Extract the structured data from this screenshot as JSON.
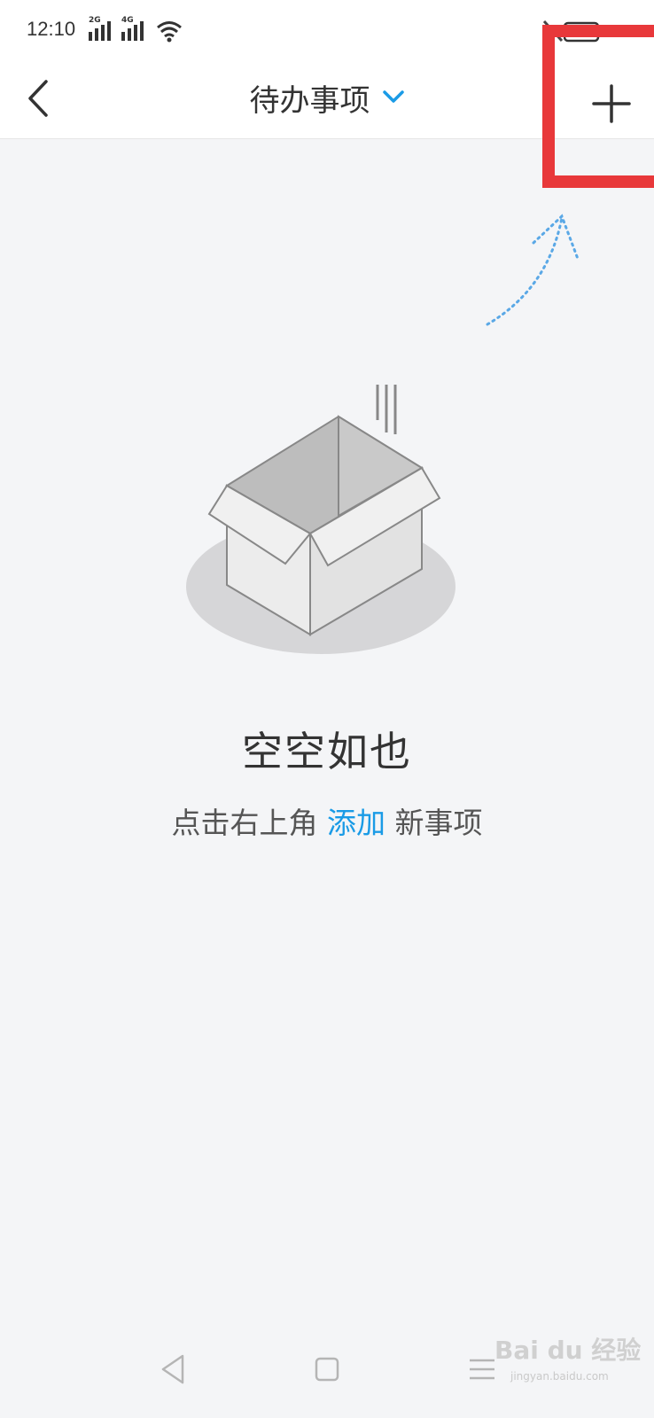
{
  "status_bar": {
    "time": "12:10",
    "sig1_label": "2G",
    "sig2_label": "4G"
  },
  "header": {
    "title": "待办事项"
  },
  "empty_state": {
    "title": "空空如也",
    "desc_prefix": "点击右上角 ",
    "desc_link": "添加",
    "desc_suffix": " 新事项"
  },
  "colors": {
    "accent": "#1a9be6",
    "highlight_box": "#e8383a",
    "background": "#f4f5f7"
  },
  "watermark": {
    "brand": "Bai du 经验",
    "url": "jingyan.baidu.com"
  }
}
